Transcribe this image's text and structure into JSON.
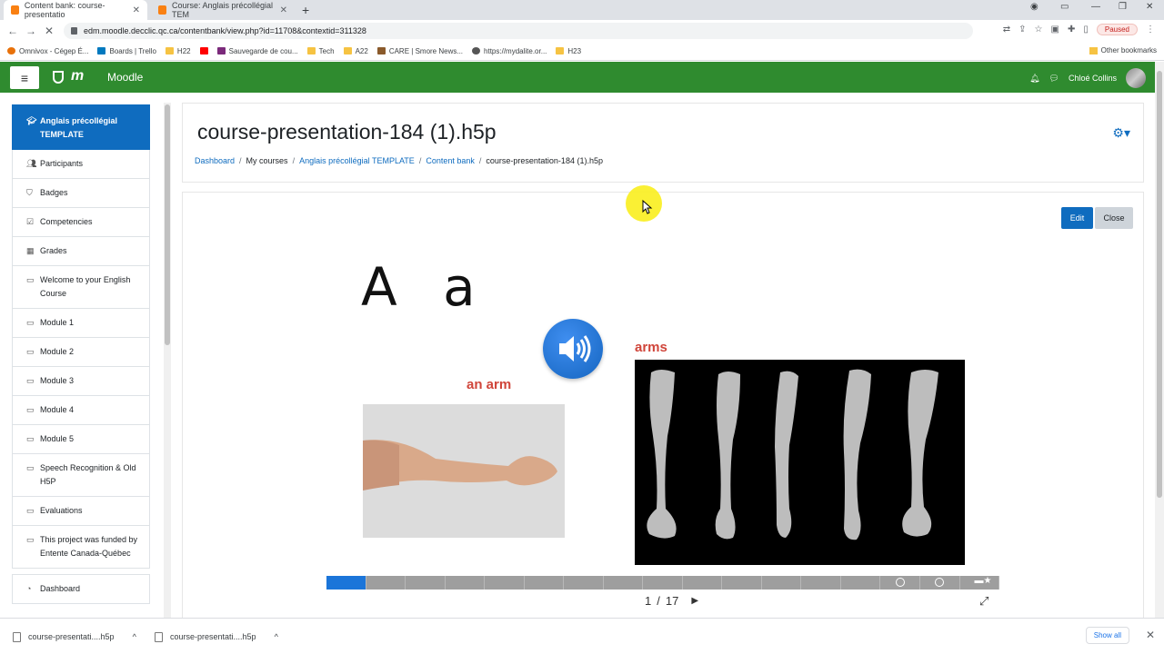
{
  "browser": {
    "tabs": [
      {
        "label": "Content bank: course-presentatio"
      },
      {
        "label": "Course: Anglais précollégial TEM"
      }
    ],
    "url": "edm.moodle.decclic.qc.ca/contentbank/view.php?id=11708&contextid=311328",
    "profile_status": "Paused",
    "bookmarks": [
      "Omnivox - Cégep É...",
      "Boards | Trello",
      "H22",
      "",
      "Sauvegarde de cou...",
      "Tech",
      "A22",
      "CARE | Smore News...",
      "https://mydalite.or...",
      "H23"
    ],
    "other_bookmarks": "Other bookmarks"
  },
  "navbar": {
    "brand": "Moodle",
    "user_name": "Chloé Collins"
  },
  "sidebar": {
    "items": [
      {
        "label": "Anglais précollégial TEMPLATE",
        "icon": "graduation-cap-icon"
      },
      {
        "label": "Participants",
        "icon": "users-icon"
      },
      {
        "label": "Badges",
        "icon": "shield-icon"
      },
      {
        "label": "Competencies",
        "icon": "checkbox-icon"
      },
      {
        "label": "Grades",
        "icon": "table-icon"
      },
      {
        "label": "Welcome to your English Course",
        "icon": "folder-icon"
      },
      {
        "label": "Module 1",
        "icon": "folder-icon"
      },
      {
        "label": "Module 2",
        "icon": "folder-icon"
      },
      {
        "label": "Module 3",
        "icon": "folder-icon"
      },
      {
        "label": "Module 4",
        "icon": "folder-icon"
      },
      {
        "label": "Module 5",
        "icon": "folder-icon"
      },
      {
        "label": "Speech Recognition & Old H5P",
        "icon": "folder-icon"
      },
      {
        "label": "Evaluations",
        "icon": "folder-icon"
      },
      {
        "label": "This project was funded by Entente Canada-Québec",
        "icon": "folder-icon"
      },
      {
        "label": "Dashboard",
        "icon": "dashboard-icon"
      }
    ]
  },
  "page": {
    "title": "course-presentation-184 (1).h5p",
    "breadcrumb": [
      "Dashboard",
      "My courses",
      "Anglais précollégial TEMPLATE",
      "Content bank",
      "course-presentation-184 (1).h5p"
    ],
    "edit_label": "Edit",
    "close_label": "Close"
  },
  "slide": {
    "letters": "A a",
    "word_singular": "an arm",
    "word_plural": "arms",
    "current_slide": 1,
    "total_slides": 17,
    "pager_separator": "/"
  },
  "downloads": {
    "items": [
      "course-presentati....h5p",
      "course-presentati....h5p"
    ],
    "show_all": "Show all"
  },
  "colors": {
    "navbar": "#2f8b2f",
    "primary": "#0f6cbf",
    "word": "#d0453a",
    "progress_current": "#1b75d9"
  }
}
